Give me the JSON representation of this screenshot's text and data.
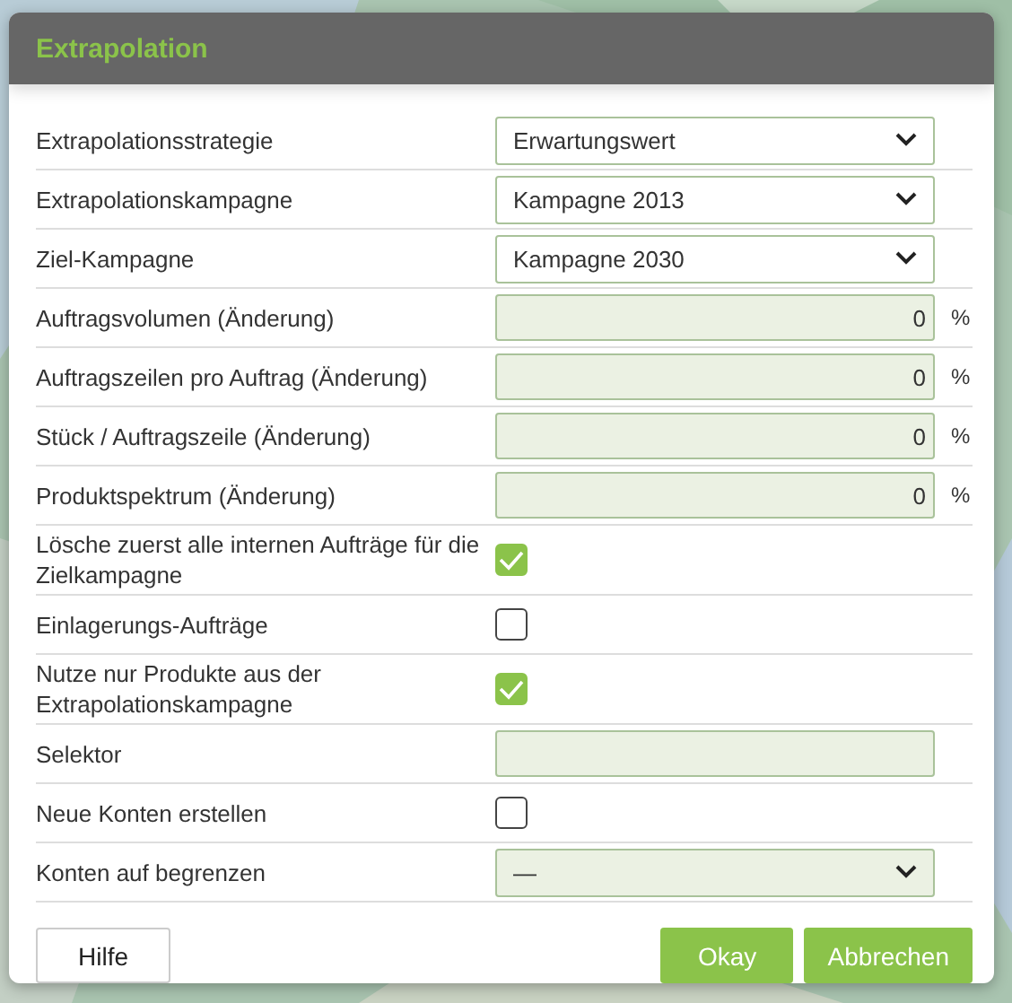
{
  "dialog": {
    "title": "Extrapolation"
  },
  "rows": [
    {
      "kind": "select",
      "label": "Extrapolationsstrategie",
      "value": "Erwartungswert",
      "tinted": false
    },
    {
      "kind": "select",
      "label": "Extrapolationskampagne",
      "value": "Kampagne 2013",
      "tinted": false
    },
    {
      "kind": "select",
      "label": "Ziel-Kampagne",
      "value": "Kampagne 2030",
      "tinted": false
    },
    {
      "kind": "number",
      "label": "Auftragsvolumen (Änderung)",
      "value": "0",
      "unit": "%"
    },
    {
      "kind": "number",
      "label": "Auftragszeilen pro Auftrag (Änderung)",
      "value": "0",
      "unit": "%"
    },
    {
      "kind": "number",
      "label": "Stück / Auftragszeile (Änderung)",
      "value": "0",
      "unit": "%"
    },
    {
      "kind": "number",
      "label": "Produktspektrum (Änderung)",
      "value": "0",
      "unit": "%"
    },
    {
      "kind": "checkbox",
      "label": "Lösche zuerst alle internen Aufträge für die Zielkampagne",
      "checked": true
    },
    {
      "kind": "checkbox",
      "label": "Einlagerungs-Aufträge",
      "checked": false
    },
    {
      "kind": "checkbox",
      "label": "Nutze nur Produkte aus der Extrapolationskampagne",
      "checked": true
    },
    {
      "kind": "text",
      "label": "Selektor"
    },
    {
      "kind": "checkbox",
      "label": "Neue Konten erstellen",
      "checked": false
    },
    {
      "kind": "select",
      "label": "Konten auf begrenzen",
      "value": "—",
      "tinted": true
    }
  ],
  "buttons": {
    "help": "Hilfe",
    "ok": "Okay",
    "cancel": "Abbrechen"
  }
}
